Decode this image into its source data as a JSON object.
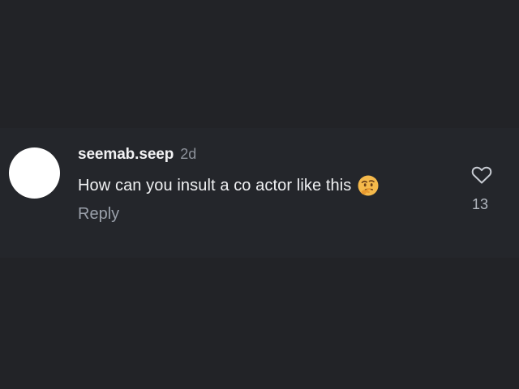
{
  "comment": {
    "username": "seemab.seep",
    "timestamp": "2d",
    "text": "How can you insult a co actor like this",
    "emoji": "thinking-face",
    "reply_label": "Reply",
    "like_count": "13"
  },
  "icons": {
    "like": "heart-outline-icon",
    "avatar": "avatar"
  },
  "colors": {
    "background": "#222327",
    "comment_background": "#24262b",
    "username": "#f2f2f4",
    "secondary_text": "#9aa0aa",
    "avatar": "#ffffff",
    "emoji": "#f5b94b"
  }
}
